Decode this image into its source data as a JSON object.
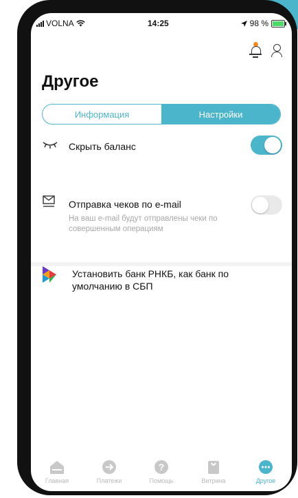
{
  "status_bar": {
    "carrier": "VOLNA",
    "time": "14:25",
    "battery": "98 %"
  },
  "page": {
    "title": "Другое"
  },
  "tabs": [
    {
      "label": "Информация",
      "active": false
    },
    {
      "label": "Настройки",
      "active": true
    }
  ],
  "settings": {
    "hide_balance": {
      "label": "Скрыть баланс",
      "enabled": true
    },
    "email_receipts": {
      "label": "Отправка чеков по e-mail",
      "description": "На ваш e-mail будут отправлены чеки по совершенным операциям",
      "enabled": false
    },
    "default_bank": {
      "label": "Установить банк РНКБ, как банк по умолчанию в СБП"
    }
  },
  "bottom_nav": [
    {
      "label": "Главная",
      "icon": "home-icon",
      "active": false
    },
    {
      "label": "Платежи",
      "icon": "arrow-right-icon",
      "active": false
    },
    {
      "label": "Помощь",
      "icon": "question-icon",
      "active": false
    },
    {
      "label": "Витрина",
      "icon": "bag-icon",
      "active": false
    },
    {
      "label": "Другое",
      "icon": "more-icon",
      "active": true
    }
  ],
  "colors": {
    "accent": "#4bb5cc",
    "notification_dot": "#ff8a1f",
    "inactive": "#b8b8b8"
  }
}
